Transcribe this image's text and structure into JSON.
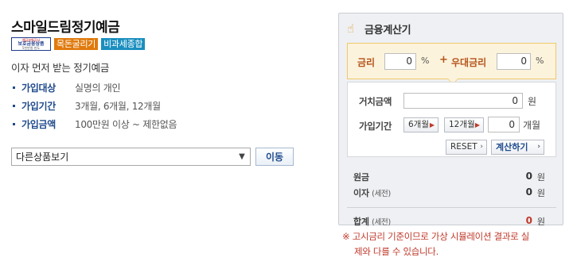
{
  "product": {
    "title": "스마일드림정기예금",
    "badges": [
      {
        "label": "목돈굴리기",
        "color": "#e07a0c"
      },
      {
        "label": "비과세종합",
        "color": "#1a8ebf"
      }
    ],
    "protect_logo": [
      "예금보험공사",
      "보호금융상품",
      "5천만원 한도"
    ],
    "description": "이자 먼저 받는 정기예금",
    "specs": [
      {
        "term": "가입대상",
        "value": "실명의 개인"
      },
      {
        "term": "가입기간",
        "value": "3개월, 6개월, 12개월"
      },
      {
        "term": "가입금액",
        "value": "100만원 이상 ~ 제한없음"
      }
    ],
    "select_value": "다른상품보기",
    "go_label": "이동"
  },
  "calculator": {
    "title": "금융계산기",
    "icon": "finger-pointer-icon",
    "rate_label": "금리",
    "rate_value": "0",
    "rate_unit": "%",
    "plus": "+",
    "bonus_label": "우대금리",
    "bonus_value": "0",
    "bonus_unit": "%",
    "deposit_label": "거치금액",
    "deposit_value": "0",
    "deposit_unit": "원",
    "period_label": "가입기간",
    "period_btn_6": "6개월",
    "period_btn_12": "12개월",
    "period_value": "0",
    "period_unit": "개월",
    "reset_label": "RESET",
    "calc_label": "계산하기",
    "results": {
      "principal_label": "원금",
      "principal_value": "0",
      "interest_label": "이자",
      "interest_note": "(세전)",
      "interest_value": "0",
      "total_label": "합계",
      "total_note": "(세전)",
      "total_value": "0",
      "unit": "원"
    }
  },
  "notice": {
    "line1": "※ 고시금리 기준이므로 가상 시뮬레이션 결과로 실",
    "line2": "제와 다를 수 있습니다."
  },
  "colors": {
    "accent_blue": "#1f4a8c",
    "accent_red": "#c0392b",
    "rate_bg": "#fcf3dc"
  }
}
